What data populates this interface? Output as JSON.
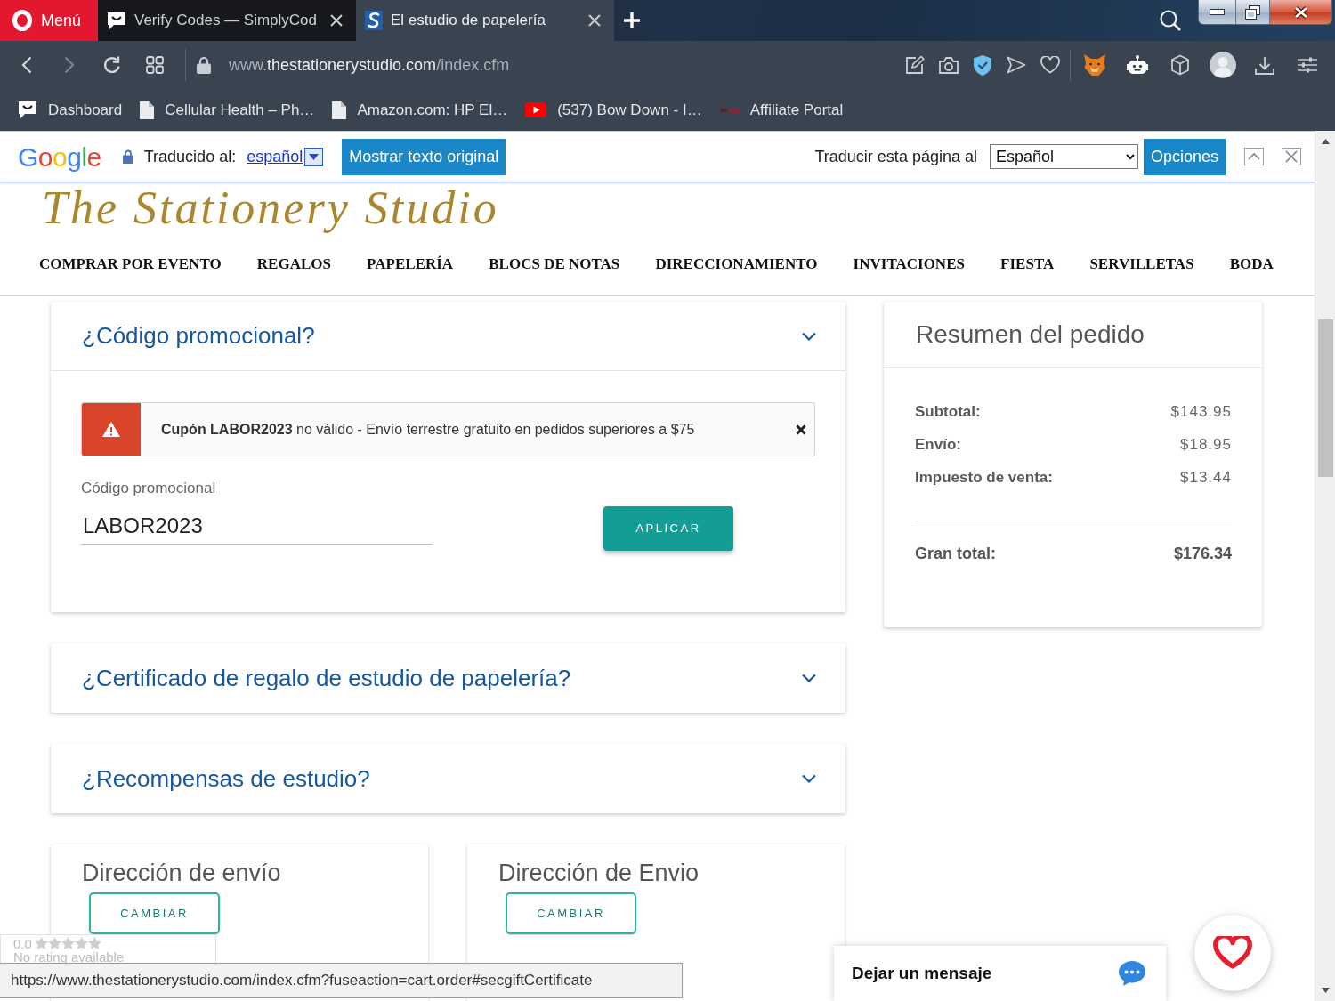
{
  "browser": {
    "menu_label": "Menú",
    "tabs": [
      {
        "title": "Verify Codes — SimplyCod",
        "selected": false,
        "kind": "smile"
      },
      {
        "title": "El estudio de papelería",
        "selected": true,
        "kind": "site"
      }
    ],
    "address": {
      "prefix": "www.",
      "domain": "thestationerystudio.com",
      "path": "/index.cfm"
    },
    "bookmarks": [
      {
        "label": "Dashboard",
        "kind": "smile"
      },
      {
        "label": "Cellular Health – Ph…",
        "kind": "page"
      },
      {
        "label": "Amazon.com: HP El…",
        "kind": "page"
      },
      {
        "label": "(537) Bow Down - I…",
        "kind": "video"
      },
      {
        "label": "Affiliate Portal",
        "kind": "faint"
      }
    ],
    "status_url": "https://www.thestationerystudio.com/index.cfm?fuseaction=cart.order#secgiftCertificate"
  },
  "translate_bar": {
    "logo": "Google",
    "translated_label": "Traducido al:",
    "language_link": "español",
    "show_original_button": "Mostrar texto original",
    "translate_label": "Traducir esta página al",
    "language_select": "Español",
    "options_button": "Opciones"
  },
  "site": {
    "logo": "The Stationery Studio",
    "nav": [
      "COMPRAR POR EVENTO",
      "REGALOS",
      "PAPELERÍA",
      "BLOCS DE NOTAS",
      "DIRECCIONAMIENTO",
      "INVITACIONES",
      "FIESTA",
      "SERVILLETAS",
      "BODA"
    ]
  },
  "accordions": [
    {
      "title": "¿Código promocional?",
      "expanded": true,
      "body": {
        "alert": "**Cupón LABOR2023** no válido - Envío terrestre gratuito en pedidos superiores a $75",
        "field_label": "Código promocional",
        "field_value": "LABOR2023",
        "apply_button": "APLICAR"
      }
    },
    {
      "title": "¿Certificado de regalo de estudio de papelería?",
      "expanded": false
    },
    {
      "title": "¿Recompensas de estudio?",
      "expanded": false
    }
  ],
  "addresses": [
    {
      "title": "Dirección de envío",
      "button": "CAMBIAR"
    },
    {
      "title": "Dirección de Envio",
      "button": "CAMBIAR"
    }
  ],
  "order_summary": {
    "title": "Resumen del pedido",
    "lines": [
      {
        "label": "Subtotal:",
        "value": "$143.95"
      },
      {
        "label": "Envío:",
        "value": "$18.95"
      },
      {
        "label": "Impuesto de venta:",
        "value": "$13.44"
      }
    ],
    "total": {
      "label": "Gran total:",
      "value": "$176.34"
    }
  },
  "rating": {
    "score": "0.0",
    "stars": 0,
    "note": "No rating available"
  },
  "chat": {
    "label": "Dejar un mensaje"
  }
}
